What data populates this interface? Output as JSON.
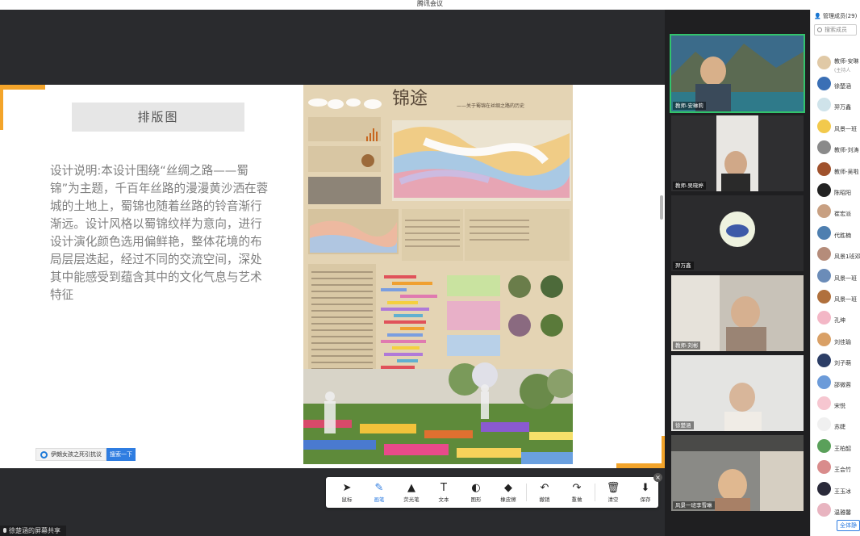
{
  "window": {
    "title": "腾讯会议"
  },
  "slide": {
    "layout_title": "排版图",
    "description": "设计说明:本设计围绕“丝绸之路——蜀锦”为主题，千百年丝路的漫漫黄沙洒在蓉城的土地上，蜀锦也随着丝路的铃音渐行渐远。设计风格以蜀锦纹样为意向，进行设计演化颜色选用偏鲜艳，整体花境的布局层层迭起，经过不同的交流空间，深处其中能感受到蕴含其中的文化气息与艺术特征",
    "poster_title": "锦途",
    "poster_subtitle": "——关于蜀锦在丝绸之路的历史",
    "caption": "伊朗女孩之死引抗议",
    "caption_button": "搜索一下"
  },
  "toolbar": {
    "tools": [
      {
        "label": "鼠标",
        "icon": "cursor-icon",
        "glyph": "➤"
      },
      {
        "label": "画笔",
        "icon": "pen-icon",
        "glyph": "✎",
        "active": true
      },
      {
        "label": "荧光笔",
        "icon": "highlighter-icon",
        "glyph": "▲"
      },
      {
        "label": "文本",
        "icon": "text-icon",
        "glyph": "T"
      },
      {
        "label": "图形",
        "icon": "shape-icon",
        "glyph": "◐"
      },
      {
        "label": "橡皮擦",
        "icon": "eraser-icon",
        "glyph": "◆"
      },
      {
        "label": "撤销",
        "icon": "undo-icon",
        "glyph": "↶"
      },
      {
        "label": "重做",
        "icon": "redo-icon",
        "glyph": "↷"
      },
      {
        "label": "清空",
        "icon": "trash-icon",
        "glyph": "🗑"
      },
      {
        "label": "保存",
        "icon": "save-icon",
        "glyph": "⬇"
      }
    ]
  },
  "share_status": "徐楚涵的屏幕共享",
  "videos": [
    {
      "name": "教师-安琳莉",
      "speaking": true
    },
    {
      "name": "教师-吴晓婷"
    },
    {
      "name": "羿万鑫"
    },
    {
      "name": "教师-刘彬"
    },
    {
      "name": "徐楚涵"
    },
    {
      "name": "风景一班李雪琳"
    }
  ],
  "members": {
    "header": "管理成员(29)",
    "search_placeholder": "搜索成员",
    "items": [
      {
        "name": "教师-安琳",
        "sub": "(主持人",
        "color": "#e0c9a6"
      },
      {
        "name": "徐楚涵",
        "color": "#3a6fb5"
      },
      {
        "name": "羿万鑫",
        "color": "#cfe3ea"
      },
      {
        "name": "风景一班",
        "color": "#f2c94c"
      },
      {
        "name": "教师-刘涛",
        "color": "#8a8a8a"
      },
      {
        "name": "教师-吴啦",
        "color": "#a0522d"
      },
      {
        "name": "陈昭阳",
        "color": "#222222"
      },
      {
        "name": "崔宏派",
        "color": "#c8a082"
      },
      {
        "name": "代胜楠",
        "color": "#4e7fb0"
      },
      {
        "name": "风景1班邓",
        "color": "#b58c7a"
      },
      {
        "name": "风景一班",
        "color": "#6b8cb8"
      },
      {
        "name": "风景一班",
        "color": "#b0703c"
      },
      {
        "name": "孔坤",
        "color": "#f3b7c6"
      },
      {
        "name": "刘佳瑜",
        "color": "#d9a066"
      },
      {
        "name": "刘子萌",
        "color": "#2c3e66"
      },
      {
        "name": "邵微蓉",
        "color": "#6c9bd9"
      },
      {
        "name": "宋悦",
        "color": "#f6c6d0"
      },
      {
        "name": "苏婕",
        "color": "#f0f0f0"
      },
      {
        "name": "王柏韶",
        "color": "#5aa05a"
      },
      {
        "name": "王会竹",
        "color": "#d98c8c"
      },
      {
        "name": "王玉冰",
        "color": "#2a2a3a"
      },
      {
        "name": "温雅馨",
        "color": "#e8b4c0"
      }
    ],
    "footer": "全体静"
  }
}
